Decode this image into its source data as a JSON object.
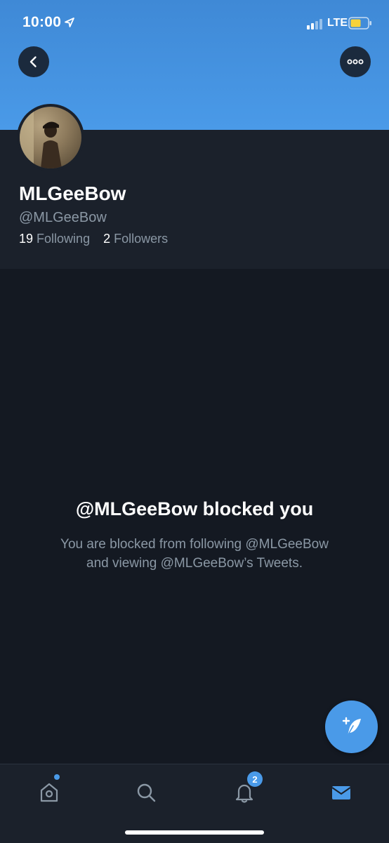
{
  "status_bar": {
    "time": "10:00",
    "network": "LTE",
    "icons": [
      "location-arrow-icon",
      "signal-icon",
      "battery-icon"
    ]
  },
  "colors": {
    "accent": "#4a9ae8",
    "background": "#141922",
    "panel": "#1b212b",
    "secondary_text": "#8b98a5"
  },
  "profile": {
    "display_name": "MLGeeBow",
    "handle": "@MLGeeBow",
    "following_count": "19",
    "following_label": "Following",
    "followers_count": "2",
    "followers_label": "Followers"
  },
  "blocked": {
    "title": "@MLGeeBow blocked you",
    "line1": "You are blocked from following @MLGeeBow",
    "line2": "and viewing @MLGeeBow’s Tweets."
  },
  "tabbar": {
    "tabs": [
      "home-icon",
      "search-icon",
      "notifications-icon",
      "messages-icon"
    ],
    "notifications_badge": "2"
  }
}
